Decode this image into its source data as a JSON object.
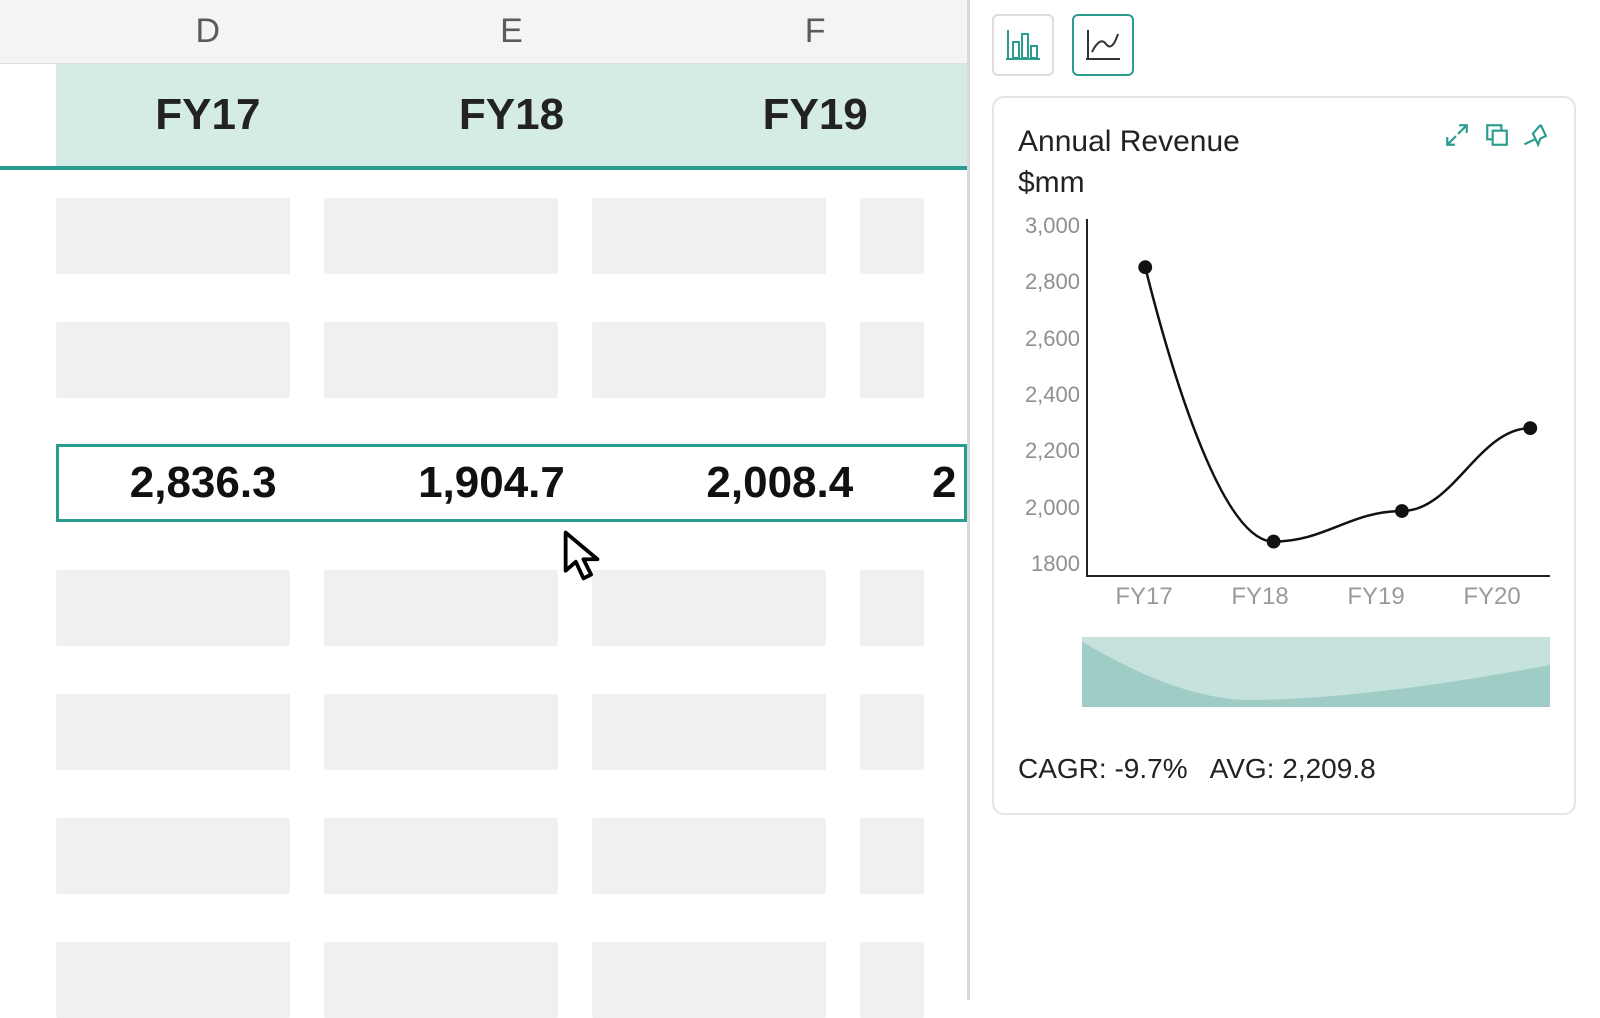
{
  "spreadsheet": {
    "columns": [
      "D",
      "E",
      "F"
    ],
    "headers": [
      "FY17",
      "FY18",
      "FY19"
    ],
    "selected_values": [
      "2,836.3",
      "1,904.7",
      "2,008.4"
    ],
    "partial_next": "2"
  },
  "chart_panel": {
    "tabs": {
      "active": "line"
    },
    "title_line1": "Annual Revenue",
    "title_line2": "$mm",
    "y_ticks": [
      "3,000",
      "2,800",
      "2,600",
      "2,400",
      "2,200",
      "2,000",
      "1800"
    ],
    "x_ticks": [
      "FY17",
      "FY18",
      "FY19",
      "FY20"
    ],
    "stats": {
      "cagr_label": "CAGR:",
      "cagr_value": "-9.7%",
      "avg_label": "AVG:",
      "avg_value": "2,209.8"
    }
  },
  "chart_data": {
    "type": "line",
    "title": "Annual Revenue $mm",
    "xlabel": "",
    "ylabel": "",
    "ylim": [
      1800,
      3000
    ],
    "categories": [
      "FY17",
      "FY18",
      "FY19",
      "FY20"
    ],
    "values": [
      2836.3,
      1904.7,
      2008.4,
      2289.8
    ]
  },
  "colors": {
    "accent": "#2b9d8e"
  }
}
